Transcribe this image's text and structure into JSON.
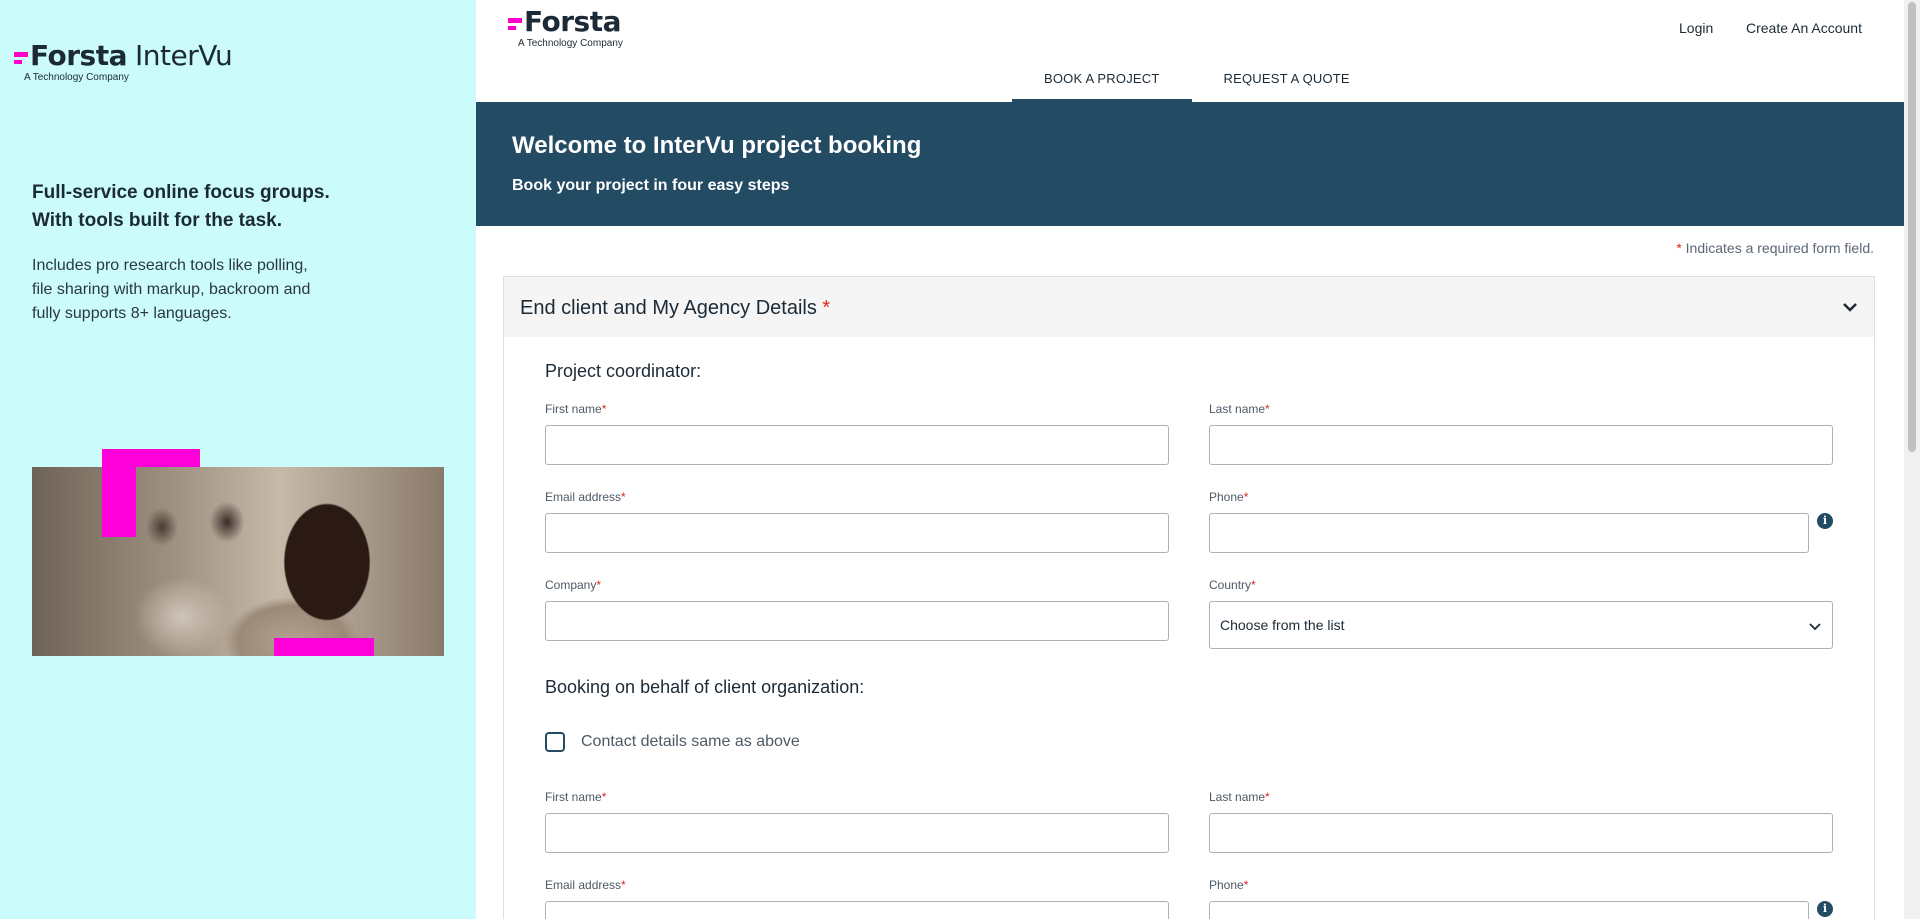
{
  "sidebar": {
    "logo_main": "Forsta",
    "logo_product": "InterVu",
    "logo_tagline": "A Technology Company",
    "headline_line1": "Full-service online focus groups.",
    "headline_line2": "With tools built for the task.",
    "description": "Includes pro research tools like polling, file sharing with markup, backroom and fully supports 8+ languages."
  },
  "header": {
    "logo_main": "Forsta",
    "logo_tagline": "A Technology Company",
    "login_label": "Login",
    "create_account_label": "Create An Account",
    "tabs": [
      {
        "label": "BOOK A PROJECT",
        "active": true
      },
      {
        "label": "REQUEST A QUOTE",
        "active": false
      }
    ]
  },
  "banner": {
    "title": "Welcome to InterVu project booking",
    "subtitle": "Book your project in four easy steps"
  },
  "form": {
    "required_star": "*",
    "required_note": "Indicates a required form field.",
    "section_title": "End client and My Agency Details",
    "coordinator_title": "Project coordinator:",
    "client_title": "Booking on behalf of client organization:",
    "labels": {
      "first_name": "First name",
      "last_name": "Last name",
      "email": "Email address",
      "phone": "Phone",
      "company": "Company",
      "country": "Country"
    },
    "country_placeholder": "Choose from the list",
    "same_as_above_label": "Contact details same as above"
  },
  "colors": {
    "accent": "#234b63",
    "brand_pink": "#ff00c8",
    "sidebar_bg": "#ccfbfb",
    "required": "#e02424"
  },
  "icons": [
    "chevron-down-icon",
    "info-icon",
    "checkbox-icon"
  ]
}
